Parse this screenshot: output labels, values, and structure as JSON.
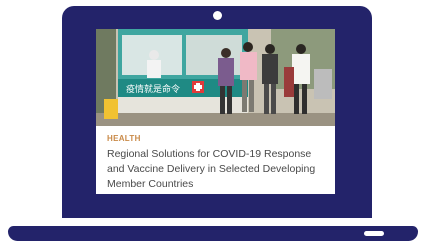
{
  "article": {
    "category": "HEALTH",
    "title": "Regional Solutions for COVID-19 Response and Vaccine Delivery in Selected Developing Member Countries"
  },
  "photo": {
    "sign_text": "疫情就是命令"
  },
  "colors": {
    "device": "#23236a",
    "category": "#c98a48",
    "headline": "#4a4a4a"
  }
}
